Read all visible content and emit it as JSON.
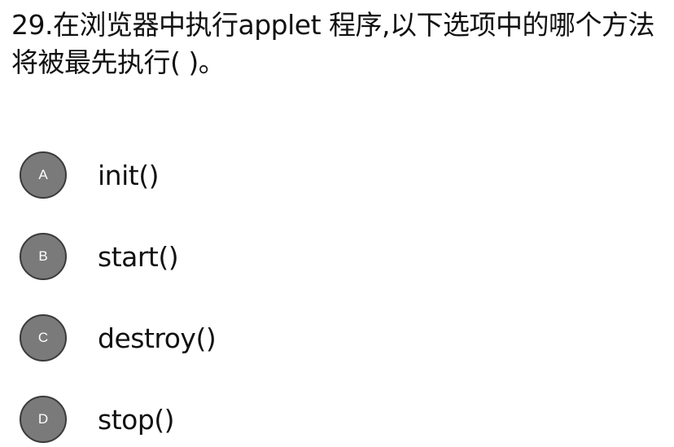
{
  "question": {
    "text": "29.在浏览器中执行applet 程序,以下选项中的哪个方法将被最先执行(  )。"
  },
  "options": [
    {
      "letter": "A",
      "text": "init()"
    },
    {
      "letter": "B",
      "text": "start()"
    },
    {
      "letter": "C",
      "text": "destroy()"
    },
    {
      "letter": "D",
      "text": "stop()"
    }
  ],
  "colors": {
    "badge_fill": "#7a7a7a",
    "badge_border": "#3a3a3a",
    "text": "#111111",
    "background": "#ffffff"
  }
}
